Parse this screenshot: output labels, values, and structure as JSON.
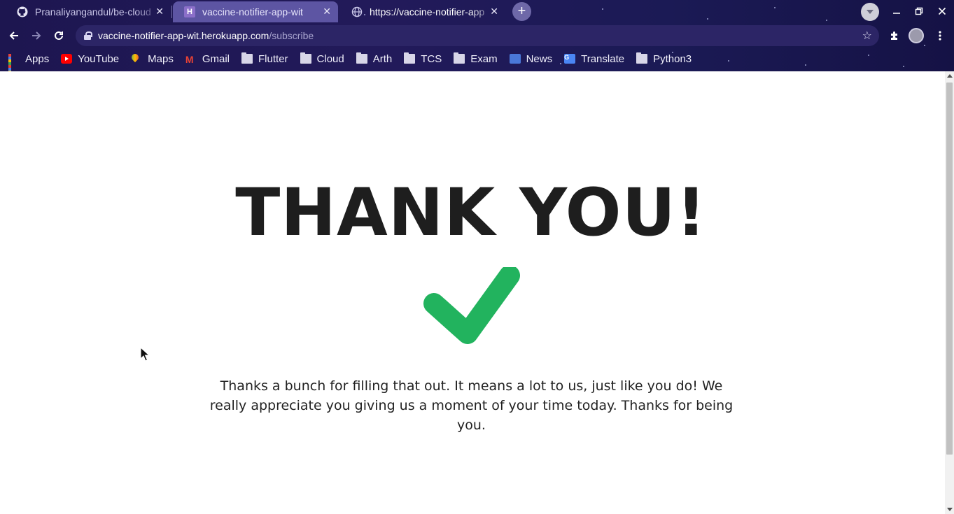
{
  "browser": {
    "tabs": [
      {
        "title": "Pranaliyangandul/be-cloud",
        "favicon": "github-icon",
        "close": "✕"
      },
      {
        "title": "vaccine-notifier-app-wit",
        "favicon": "heroku-icon",
        "close": "✕"
      },
      {
        "title": "https://vaccine-notifier-app",
        "favicon": "globe-icon",
        "close": "✕"
      }
    ],
    "new_tab_label": "+",
    "address": {
      "host": "vaccine-notifier-app-wit.herokuapp.com",
      "path": "/subscribe"
    },
    "bookmarks": [
      {
        "label": "Apps",
        "icon": "apps-grid-icon"
      },
      {
        "label": "YouTube",
        "icon": "youtube-icon"
      },
      {
        "label": "Maps",
        "icon": "maps-icon"
      },
      {
        "label": "Gmail",
        "icon": "gmail-icon"
      },
      {
        "label": "Flutter",
        "icon": "folder-icon"
      },
      {
        "label": "Cloud",
        "icon": "folder-icon"
      },
      {
        "label": "Arth",
        "icon": "folder-icon"
      },
      {
        "label": "TCS",
        "icon": "folder-icon"
      },
      {
        "label": "Exam",
        "icon": "folder-icon"
      },
      {
        "label": "News",
        "icon": "google-news-icon"
      },
      {
        "label": "Translate",
        "icon": "google-translate-icon"
      },
      {
        "label": "Python3",
        "icon": "folder-icon"
      }
    ],
    "colors": {
      "theme_dark": "#1d1650",
      "active_tab": "#5d55a3"
    }
  },
  "page": {
    "heading": "THANK YOU!",
    "check_icon": "checkmark-icon",
    "check_color": "#22b35e",
    "message": "Thanks a bunch for filling that out. It means a lot to us, just like you do! We really appreciate you giving us a moment of your time today. Thanks for being you."
  }
}
